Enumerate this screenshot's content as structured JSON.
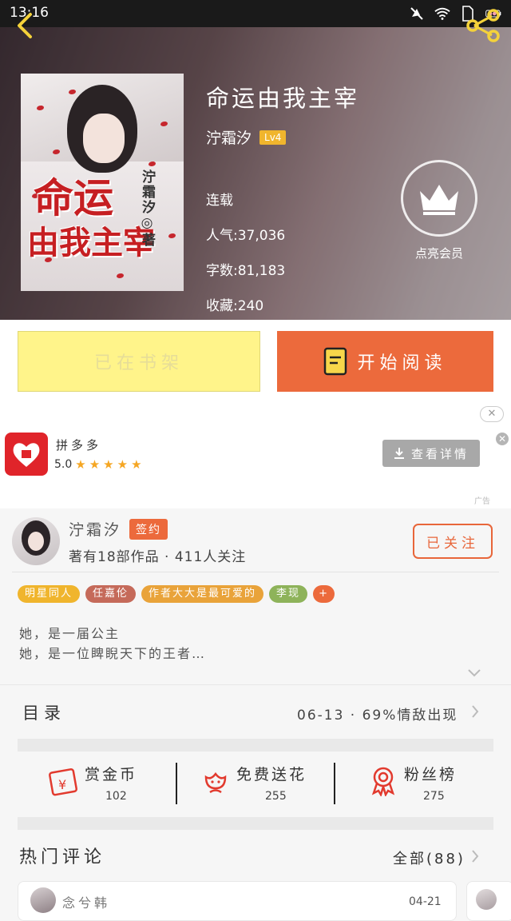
{
  "status_bar": {
    "time": "13:16"
  },
  "book": {
    "title": "命运由我主宰",
    "author": "泞霜汐",
    "level": "Lv4",
    "status": "连载",
    "popularity": "人气:37,036",
    "word_count": "字数:81,183",
    "favorites": "收藏:240",
    "cover": {
      "title_line1": "命运",
      "title_line2": "由我主宰",
      "author_mark": "泞霜汐◎著"
    }
  },
  "vip": {
    "label": "点亮会员"
  },
  "actions": {
    "shelf_label": "已在书架",
    "read_label": "开始阅读"
  },
  "ad": {
    "app_name": "拼多多",
    "rating": "5.0",
    "stars": 5,
    "button_label": "查看详情",
    "close_label": "✕",
    "tag": "广告"
  },
  "author": {
    "name": "泞霜汐",
    "badge": "签约",
    "stats": "著有18部作品 · 411人关注",
    "follow_label": "已关注"
  },
  "tags": [
    {
      "label": "明星同人",
      "color": "#f0b52d"
    },
    {
      "label": "任嘉伦",
      "color": "#c56a5a"
    },
    {
      "label": "作者大大是最可爱的",
      "color": "#e9a33a"
    },
    {
      "label": "李现",
      "color": "#8eb35a"
    },
    {
      "label": "+",
      "color": "#ec6a3c"
    }
  ],
  "description": {
    "line1": "她，是一届公主",
    "line2": "她，是一位睥睨天下的王者…"
  },
  "toc": {
    "label": "目录",
    "latest": "06-13 · 69%情敌出现"
  },
  "gifts": [
    {
      "label": "赏金币",
      "count": "102",
      "icon": "coin-envelope-icon"
    },
    {
      "label": "免费送花",
      "count": "255",
      "icon": "flower-icon"
    },
    {
      "label": "粉丝榜",
      "count": "275",
      "icon": "medal-icon"
    }
  ],
  "comments": {
    "title": "热门评论",
    "all_label": "全部(88)",
    "first": {
      "user": "念兮韩",
      "date": "04-21"
    }
  },
  "colors": {
    "accent": "#ec6a3c",
    "shelf": "#fff48a",
    "gold": "#f0b52d"
  }
}
